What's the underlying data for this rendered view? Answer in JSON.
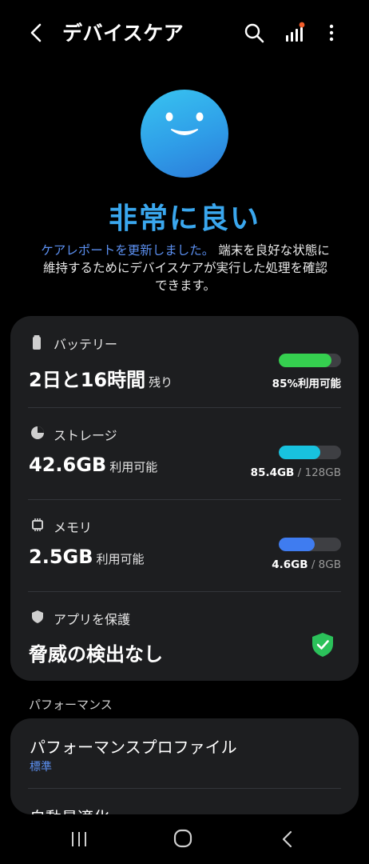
{
  "app": {
    "title": "デバイスケア"
  },
  "hero": {
    "status": "非常に良い",
    "report_link": "ケアレポートを更新しました。",
    "description_line1": "端末を良好な状態に",
    "description_line2": "維持するためにデバイスケアが実行した処理を確認",
    "description_line3": "できます。"
  },
  "battery": {
    "label": "バッテリー",
    "value": "2日と16時間",
    "suffix": "残り",
    "percent_text": "85%利用可能",
    "level": 0.85,
    "color": "#35d04f"
  },
  "storage": {
    "label": "ストレージ",
    "value": "42.6GB",
    "suffix": "利用可能",
    "used": "85.4GB",
    "total": "/ 128GB",
    "level": 0.667,
    "color": "#18c2df"
  },
  "memory": {
    "label": "メモリ",
    "value": "2.5GB",
    "suffix": "利用可能",
    "used": "4.6GB",
    "total": "/ 8GB",
    "level": 0.575,
    "color": "#3f7cf0"
  },
  "protection": {
    "label": "アプリを保護",
    "value": "脅威の検出なし",
    "color": "#2bc15a"
  },
  "performance": {
    "section_title": "パフォーマンス",
    "profile_title": "パフォーマンスプロファイル",
    "profile_value": "標準",
    "auto_optimize": "自動最適化"
  },
  "icons": {
    "back": "back-arrow-icon",
    "search": "search-icon",
    "signal": "signal-notification-icon",
    "more": "more-vert-icon"
  }
}
